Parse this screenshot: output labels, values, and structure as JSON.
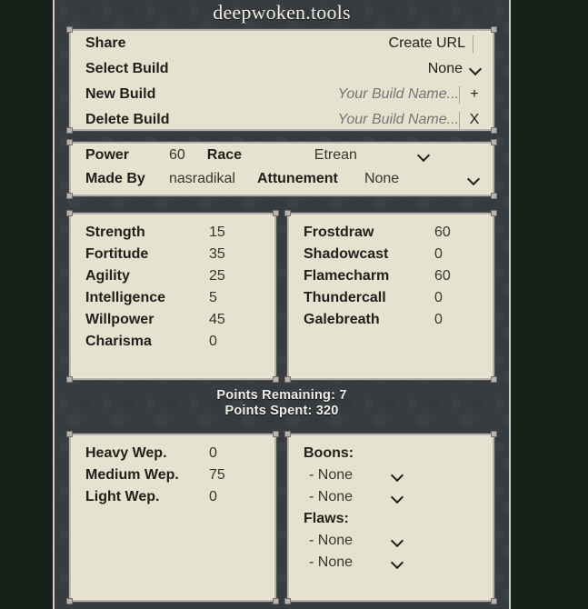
{
  "site": {
    "title": "deepwoken.tools"
  },
  "build_panel": {
    "rows": [
      {
        "label": "Share",
        "kind": "action",
        "action_label": "Create URL"
      },
      {
        "label": "Select Build",
        "kind": "select",
        "value": "None"
      },
      {
        "label": "New Build",
        "kind": "input",
        "input_value": "",
        "placeholder": "Your Build Name...",
        "button_label": "+"
      },
      {
        "label": "Delete Build",
        "kind": "input",
        "input_value": "",
        "placeholder": "Your Build Name...",
        "button_label": "X"
      }
    ]
  },
  "meta_panel": {
    "power_label": "Power",
    "power_value": "60",
    "made_by_label": "Made By",
    "made_by_value": "nasradikal",
    "race_label": "Race",
    "race_value": "Etrean",
    "attunement_label": "Attunement",
    "attunement_value": "None"
  },
  "base_stats": {
    "rows": [
      {
        "name": "Strength",
        "value": "15"
      },
      {
        "name": "Fortitude",
        "value": "35"
      },
      {
        "name": "Agility",
        "value": "25"
      },
      {
        "name": "Intelligence",
        "value": "5"
      },
      {
        "name": "Willpower",
        "value": "45"
      },
      {
        "name": "Charisma",
        "value": "0"
      }
    ]
  },
  "attunement_stats": {
    "rows": [
      {
        "name": "Frostdraw",
        "value": "60"
      },
      {
        "name": "Shadowcast",
        "value": "0"
      },
      {
        "name": "Flamecharm",
        "value": "60"
      },
      {
        "name": "Thundercall",
        "value": "0"
      },
      {
        "name": "Galebreath",
        "value": "0"
      }
    ]
  },
  "points": {
    "remaining": "Points Remaining: 7",
    "spent": "Points Spent: 320"
  },
  "weapon_stats": {
    "rows": [
      {
        "name": "Heavy Wep.",
        "value": "0"
      },
      {
        "name": "Medium Wep.",
        "value": "75"
      },
      {
        "name": "Light Wep.",
        "value": "0"
      }
    ]
  },
  "boons_flaws": {
    "boons_label": "Boons:",
    "boons": [
      {
        "value": "- None"
      },
      {
        "value": "- None"
      }
    ],
    "flaws_label": "Flaws:",
    "flaws": [
      {
        "value": "- None"
      },
      {
        "value": "- None"
      }
    ]
  },
  "colors": {
    "page_margin": "#16211a",
    "content_bg": "#373c40",
    "panel_bg": "#e5e2cf",
    "panel_border": "#b6b1ab",
    "text_dark": "#23201c",
    "text_muted": "#9b968c",
    "title_text": "#f3efe6"
  }
}
